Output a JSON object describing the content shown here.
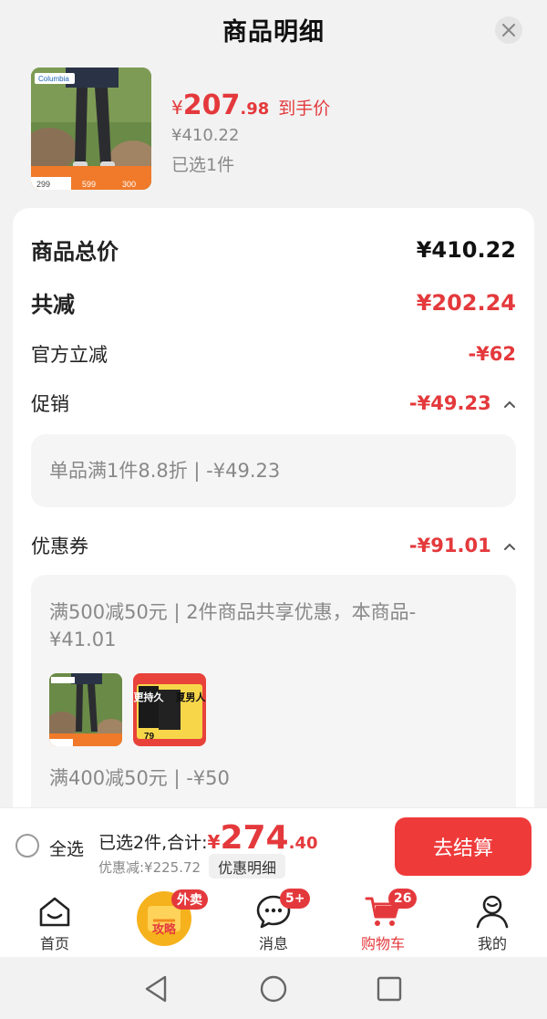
{
  "header": {
    "title": "商品明细"
  },
  "product": {
    "thumb_brand": "Columbia",
    "thumb_prices": [
      "299",
      "599",
      "300"
    ],
    "price_yen": "¥",
    "price_int": "207",
    "price_dec": ".98",
    "price_tag": "到手价",
    "original_price": "¥410.22",
    "selected_count": "已选1件"
  },
  "summary": {
    "total_label": "商品总价",
    "total_value": "¥410.22",
    "reduce_label": "共减",
    "reduce_value": "¥202.24",
    "official_label": "官方立减",
    "official_value": "-¥62",
    "promo_label": "促销",
    "promo_value": "-¥49.23",
    "promo_detail": "单品满1件8.8折 | -¥49.23",
    "coupon_label": "优惠券",
    "coupon_value": "-¥91.01",
    "coupon_detail_1": "满500减50元 | 2件商品共享优惠，本商品-¥41.01",
    "coupon_detail_2": "满400减50元 | -¥50",
    "coupon_thumb2_text": [
      "更持久",
      "夏男人",
      "79"
    ]
  },
  "bottom_bar": {
    "select_all": "全选",
    "total_label": "已选2件,合计:",
    "total_yen": "¥",
    "total_int": "274",
    "total_dec": ".40",
    "discount": "优惠减:¥225.72",
    "detail_button": "优惠明细",
    "checkout": "去结算"
  },
  "tabbar": {
    "items": [
      {
        "label": "首页",
        "icon": "home-icon"
      },
      {
        "label": "攻略",
        "icon": "guide-icon",
        "badge": "外卖"
      },
      {
        "label": "消息",
        "icon": "message-icon",
        "badge": "5+"
      },
      {
        "label": "购物车",
        "icon": "cart-icon",
        "badge": "26",
        "active": true
      },
      {
        "label": "我的",
        "icon": "profile-icon"
      }
    ]
  },
  "colors": {
    "accent": "#e4393c",
    "checkout": "#ef3a3a"
  }
}
